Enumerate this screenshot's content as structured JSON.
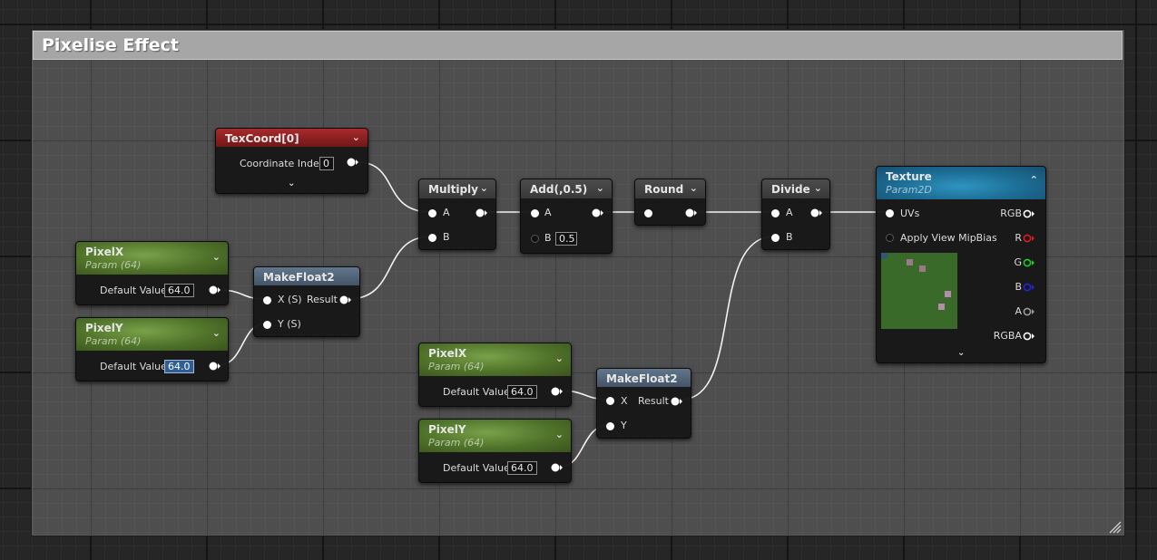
{
  "comment": {
    "title": "Pixelise Effect"
  },
  "nodes": {
    "texcoord": {
      "title": "TexCoord[0]",
      "label": "Coordinate Index",
      "value": "0"
    },
    "pixelx_1": {
      "title": "PixelX",
      "subtitle": "Param (64)",
      "label": "Default Value",
      "value": "64.0"
    },
    "pixely_1": {
      "title": "PixelY",
      "subtitle": "Param (64)",
      "label": "Default Value",
      "value": "64.0"
    },
    "makefloat2_1": {
      "title": "MakeFloat2",
      "in_x": "X (S)",
      "in_y": "Y (S)",
      "out": "Result"
    },
    "multiply": {
      "title": "Multiply",
      "in_a": "A",
      "in_b": "B"
    },
    "add": {
      "title": "Add(,0.5)",
      "in_a": "A",
      "in_b": "B",
      "b_value": "0.5"
    },
    "round": {
      "title": "Round"
    },
    "divide": {
      "title": "Divide",
      "in_a": "A",
      "in_b": "B"
    },
    "pixelx_2": {
      "title": "PixelX",
      "subtitle": "Param (64)",
      "label": "Default Value",
      "value": "64.0"
    },
    "pixely_2": {
      "title": "PixelY",
      "subtitle": "Param (64)",
      "label": "Default Value",
      "value": "64.0"
    },
    "makefloat2_2": {
      "title": "MakeFloat2",
      "in_x": "X",
      "in_y": "Y",
      "out": "Result"
    },
    "texture": {
      "title": "Texture",
      "subtitle": "Param2D",
      "in_uvs": "UVs",
      "in_mipbias": "Apply View MipBias",
      "outputs": [
        "RGB",
        "R",
        "G",
        "B",
        "A",
        "RGBA"
      ],
      "output_colors": [
        "#ffffff",
        "#e01b1b",
        "#1bd01b",
        "#2424e0",
        "#9a9a9a",
        "#ffffff"
      ]
    }
  },
  "icons": {
    "collapse": "chevron-down-icon",
    "expand": "chevron-up-icon",
    "resize": "resize-grip-icon"
  },
  "colors": {
    "param_header": "#5a7f31",
    "texcoord_header": "#8f2222",
    "makefloat_header": "#566a80",
    "texture_header": "#1f77a4",
    "comment_header": "#a6a6a6"
  }
}
